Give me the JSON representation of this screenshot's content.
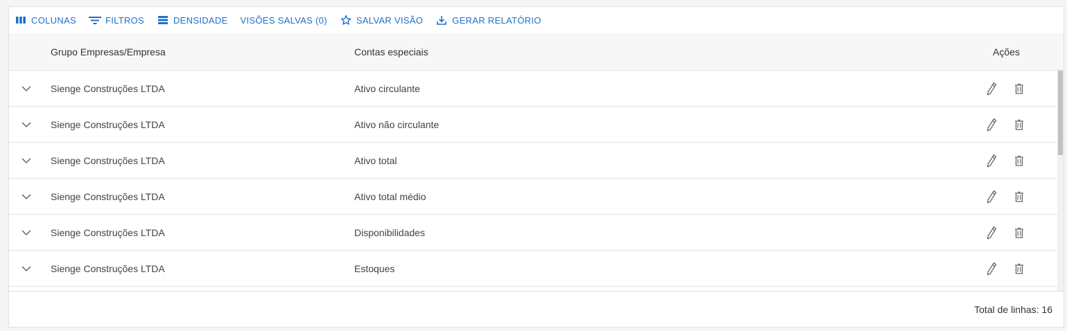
{
  "toolbar": {
    "columns_label": "COLUNAS",
    "filters_label": "FILTROS",
    "density_label": "DENSIDADE",
    "saved_views_label": "VISÕES SALVAS (0)",
    "save_view_label": "SALVAR VISÃO",
    "report_label": "GERAR RELATÓRIO",
    "accent_color": "#1e6fc9"
  },
  "table": {
    "headers": {
      "group": "Grupo Empresas/Empresa",
      "conta": "Contas especiais",
      "actions": "Ações"
    },
    "rows": [
      {
        "group": "Sienge Construções LTDA",
        "conta": "Ativo circulante"
      },
      {
        "group": "Sienge Construções LTDA",
        "conta": "Ativo não circulante"
      },
      {
        "group": "Sienge Construções LTDA",
        "conta": "Ativo total"
      },
      {
        "group": "Sienge Construções LTDA",
        "conta": "Ativo total médio"
      },
      {
        "group": "Sienge Construções LTDA",
        "conta": "Disponibilidades"
      },
      {
        "group": "Sienge Construções LTDA",
        "conta": "Estoques"
      }
    ],
    "row_icons": [
      "chevron-down-icon",
      "pencil-icon",
      "trash-icon"
    ]
  },
  "footer": {
    "total_label": "Total de linhas: 16"
  }
}
